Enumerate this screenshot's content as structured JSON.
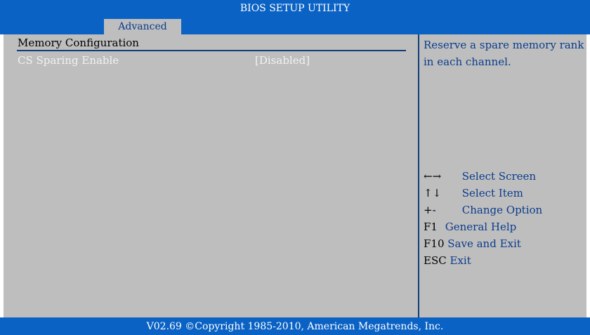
{
  "header": {
    "title": "BIOS SETUP UTILITY",
    "tabs": [
      {
        "label": "Advanced"
      }
    ]
  },
  "main": {
    "section_title": "Memory Configuration",
    "options": [
      {
        "label": "CS Sparing Enable",
        "value": "[Disabled]"
      }
    ]
  },
  "help": {
    "text": "Reserve a spare memory rank in each channel."
  },
  "keys": [
    {
      "key": "←→",
      "desc": "Select Screen"
    },
    {
      "key": "↑↓",
      "desc": "Select Item"
    },
    {
      "key": "+-",
      "desc": "Change Option"
    },
    {
      "key": "F1",
      "desc": "General Help"
    },
    {
      "key": "F10",
      "desc": "Save and Exit"
    },
    {
      "key": "ESC",
      "desc": "Exit"
    }
  ],
  "footer": {
    "copyright": "V02.69 ©Copyright 1985-2010, American Megatrends, Inc."
  },
  "colors": {
    "bar_blue": "#0A62C4",
    "panel_gray": "#BEBEBE",
    "text_blue": "#0A3C8C",
    "highlight_white": "#F2F2F2"
  }
}
